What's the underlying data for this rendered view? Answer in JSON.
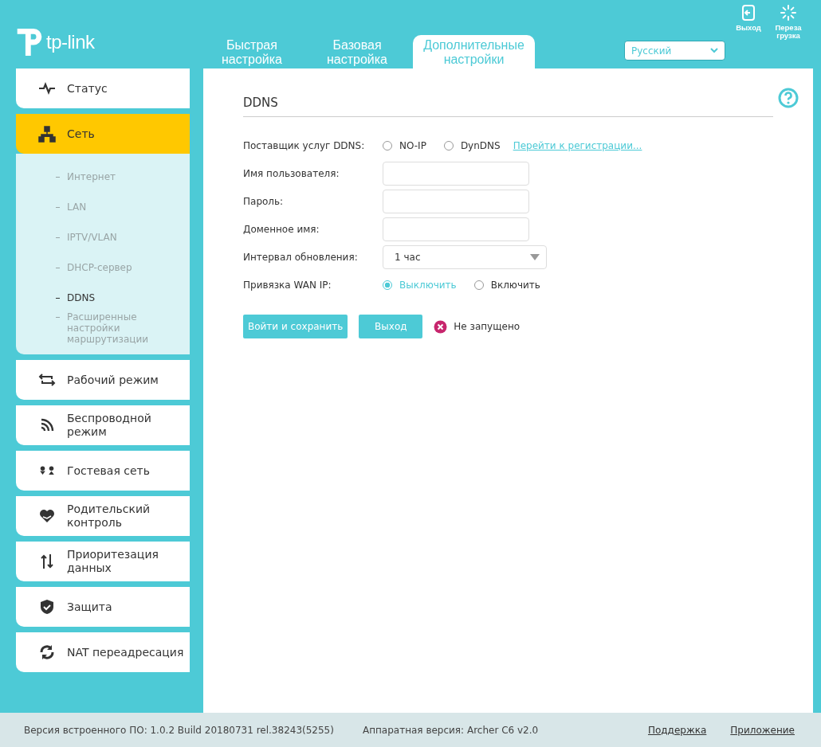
{
  "header": {
    "logo_text": "tp-link",
    "tabs": [
      {
        "label": "Быстрая настройка",
        "selected": false
      },
      {
        "label": "Базовая настройка",
        "selected": false
      },
      {
        "label": "Дополнительные настройки",
        "selected": true
      }
    ],
    "language": "Русский",
    "actions": [
      {
        "kind": "logout",
        "label": "Выход"
      },
      {
        "kind": "reboot",
        "label": "Перезагрузка"
      }
    ]
  },
  "sidebar": {
    "items": [
      {
        "label": "Статус",
        "selected": false,
        "expanded": false
      },
      {
        "label": "Сеть",
        "selected": true,
        "expanded": true,
        "children": [
          {
            "label": "Интернет",
            "selected": false
          },
          {
            "label": "LAN",
            "selected": false
          },
          {
            "label": "IPTV/VLAN",
            "selected": false
          },
          {
            "label": "DHCP-сервер",
            "selected": false
          },
          {
            "label": "DDNS",
            "selected": true
          },
          {
            "label": "Расширенные настройки маршрутизации",
            "selected": false
          }
        ]
      },
      {
        "label": "Рабочий режим",
        "selected": false,
        "expanded": false
      },
      {
        "label": "Беспроводной режим",
        "selected": false,
        "expanded": false
      },
      {
        "label": "Гостевая сеть",
        "selected": false,
        "expanded": false
      },
      {
        "label": "Родительский контроль",
        "selected": false,
        "expanded": false
      },
      {
        "label": "Приоритезация данных",
        "selected": false,
        "expanded": false
      },
      {
        "label": "Защита",
        "selected": false,
        "expanded": false
      },
      {
        "label": "NAT переадресация",
        "selected": false,
        "expanded": false
      }
    ]
  },
  "main": {
    "title": "DDNS",
    "fields": [
      {
        "kind": "radio",
        "label": "Поставщик услуг DDNS:",
        "options": [
          {
            "label": "NO-IP",
            "selected": false
          },
          {
            "label": "DynDNS",
            "selected": false
          }
        ],
        "link": "Перейти к регистрации..."
      },
      {
        "kind": "text",
        "label": "Имя пользователя:"
      },
      {
        "kind": "text",
        "label": "Пароль:"
      },
      {
        "kind": "text",
        "label": "Доменное имя:"
      },
      {
        "kind": "select",
        "label": "Интервал обновления:",
        "value": "1 час"
      },
      {
        "kind": "radio",
        "label": "Привязка WAN IP:",
        "options": [
          {
            "label": "Выключить",
            "selected": true
          },
          {
            "label": "Включить",
            "selected": false
          }
        ]
      }
    ],
    "buttons": [
      {
        "label": "Войти и сохранить"
      },
      {
        "label": "Выход"
      }
    ],
    "status": {
      "text": "Не запущено",
      "running": false
    }
  },
  "footer": {
    "firmware": "Версия встроенного ПО: 1.0.2 Build 20180731 rel.38243(5255)",
    "hardware": "Аппаратная версия: Archer C6 v2.0",
    "links": [
      "Поддержка",
      "Приложение"
    ]
  }
}
